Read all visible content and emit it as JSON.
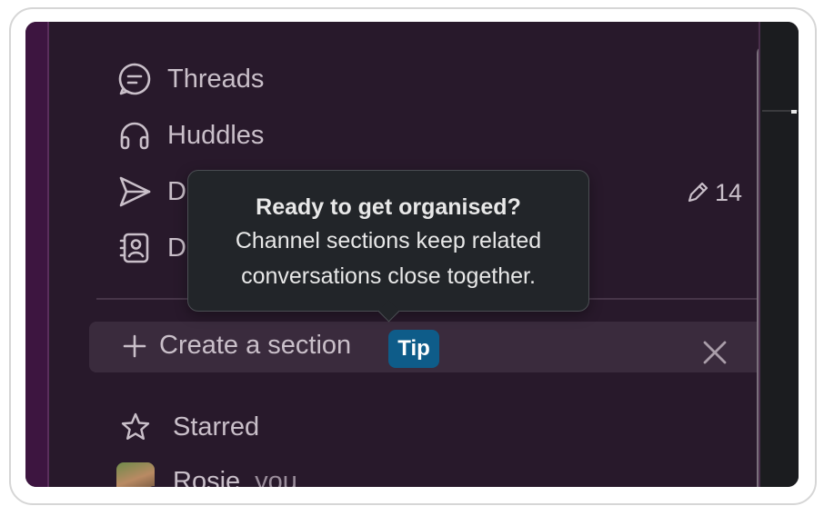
{
  "sidebar": {
    "nav_items": [
      {
        "label": "Threads",
        "icon": "threads-icon"
      },
      {
        "label": "Huddles",
        "icon": "headphones-icon"
      },
      {
        "label": "Drafts & sent",
        "visible_label": "Dra",
        "icon": "send-icon"
      },
      {
        "label": "Directories",
        "visible_label": "Dire",
        "icon": "directory-icon"
      }
    ],
    "draft_count": "14",
    "create_section": {
      "label": "Create a section",
      "badge": "Tip"
    },
    "starred_label": "Starred",
    "dm": {
      "name": "Rosie",
      "suffix": "you"
    }
  },
  "tooltip": {
    "title": "Ready to get organised?",
    "body_line1": "Channel sections keep related",
    "body_line2": "conversations close together."
  },
  "colors": {
    "sidebar_bg": "#28192b",
    "rail": "#3d1540",
    "tip_badge": "#0e5c89",
    "tooltip_bg": "#222529",
    "text": "#c9bfc9"
  }
}
